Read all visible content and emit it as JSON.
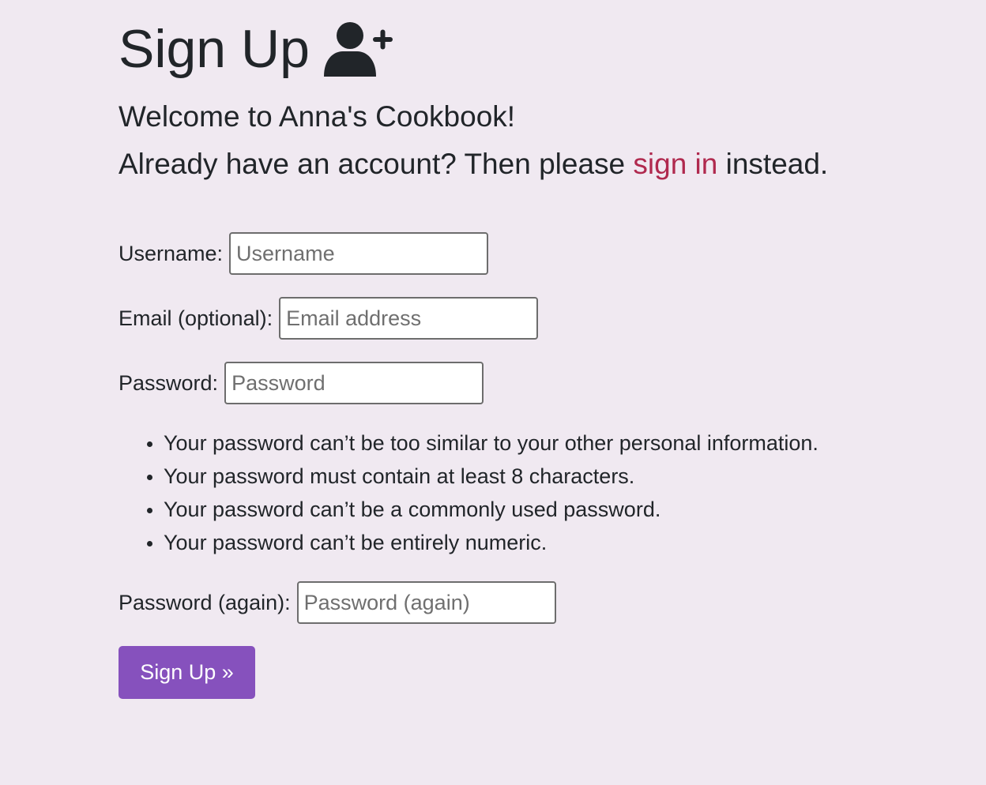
{
  "heading": {
    "title": "Sign Up",
    "icon": "user-plus-icon"
  },
  "intro": {
    "welcome": "Welcome to Anna's Cookbook!",
    "account_prefix": "Already have an account? Then please ",
    "signin_link": "sign in",
    "account_suffix": " instead."
  },
  "form": {
    "username": {
      "label": "Username:",
      "placeholder": "Username",
      "value": ""
    },
    "email": {
      "label": "Email (optional):",
      "placeholder": "Email address",
      "value": ""
    },
    "password": {
      "label": "Password:",
      "placeholder": "Password",
      "value": ""
    },
    "password_help": [
      "Your password can’t be too similar to your other personal information.",
      "Your password must contain at least 8 characters.",
      "Your password can’t be a commonly used password.",
      "Your password can’t be entirely numeric."
    ],
    "password_again": {
      "label": "Password (again):",
      "placeholder": "Password (again)",
      "value": ""
    },
    "submit_label": "Sign Up »"
  },
  "colors": {
    "background": "#f0e9f1",
    "text": "#212529",
    "link": "#b0294e",
    "button": "#8651bd",
    "button_text": "#ffffff"
  }
}
